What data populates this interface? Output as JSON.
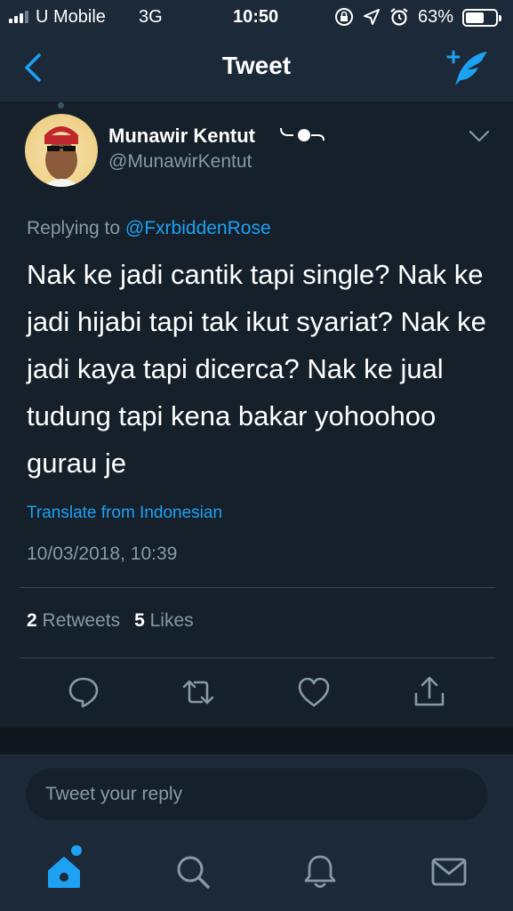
{
  "status_bar": {
    "carrier": "U Mobile",
    "network": "3G",
    "time": "10:50",
    "battery_percent": "63%",
    "battery_level": 0.63,
    "signal_bars": 3,
    "icons": [
      "orientation-lock-icon",
      "location-arrow-icon",
      "alarm-icon"
    ]
  },
  "header": {
    "title": "Tweet",
    "back_icon": "chevron-left-icon",
    "compose_icon": "compose-tweet-icon"
  },
  "tweet": {
    "author_name": "Munawir Kentut",
    "author_handle": "@MunawirKentut",
    "replying_prefix": "Replying to",
    "replying_to": "@FxrbiddenRose",
    "text": "Nak ke jadi cantik tapi single? Nak ke jadi hijabi tapi tak ikut syariat? Nak ke jadi kaya tapi dicerca? Nak ke jual tudung tapi kena bakar yohoohoo gurau je",
    "translate_label": "Translate from Indonesian",
    "timestamp": "10/03/2018, 10:39",
    "retweets_count": "2",
    "retweets_label": "Retweets",
    "likes_count": "5",
    "likes_label": "Likes"
  },
  "actions": [
    "reply-icon",
    "retweet-icon",
    "like-icon",
    "share-icon"
  ],
  "reply": {
    "placeholder": "Tweet your reply"
  },
  "tab_bar": [
    "home-icon",
    "search-icon",
    "notifications-icon",
    "messages-icon"
  ],
  "colors": {
    "accent": "#1da1f2",
    "background": "#15202b",
    "header": "#1c2938",
    "secondary_text": "#8899a6"
  }
}
